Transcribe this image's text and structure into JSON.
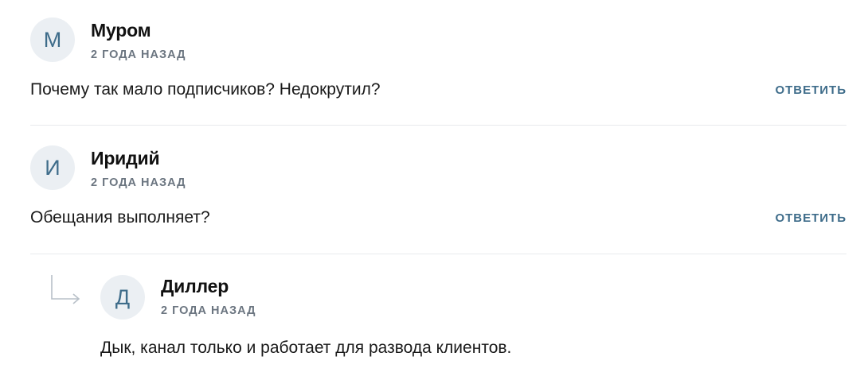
{
  "comments": [
    {
      "avatar_letter": "М",
      "author": "Муром",
      "date": "2 года назад",
      "text": "Почему так мало подписчиков? Недокрутил?",
      "reply_label": "ОТВЕТИТЬ"
    },
    {
      "avatar_letter": "И",
      "author": "Иридий",
      "date": "2 года назад",
      "text": "Обещания выполняет?",
      "reply_label": "ОТВЕТИТЬ"
    }
  ],
  "reply": {
    "avatar_letter": "Д",
    "author": "Диллер",
    "date": "2 года назад",
    "text": "Дык, канал только и работает для развода клиентов."
  },
  "icons": {
    "reply_arrow": "reply-arrow-icon"
  },
  "colors": {
    "accent": "#3e6c8a",
    "avatar_bg": "#ebeff3",
    "muted": "#6b7580",
    "divider": "#e8eaed"
  }
}
